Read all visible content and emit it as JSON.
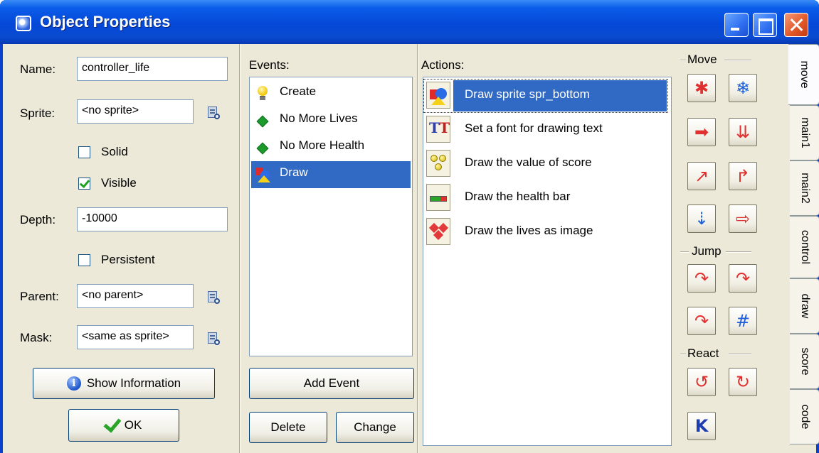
{
  "window": {
    "title": "Object Properties",
    "controls": {
      "minimize": "minimize-icon",
      "maximize": "maximize-icon",
      "close": "close-icon"
    }
  },
  "properties": {
    "name_label": "Name:",
    "name_value": "controller_life",
    "sprite_label": "Sprite:",
    "sprite_value": "<no sprite>",
    "solid_label": "Solid",
    "solid_checked": false,
    "visible_label": "Visible",
    "visible_checked": true,
    "depth_label": "Depth:",
    "depth_value": "-10000",
    "persistent_label": "Persistent",
    "persistent_checked": false,
    "parent_label": "Parent:",
    "parent_value": "<no parent>",
    "mask_label": "Mask:",
    "mask_value": "<same as sprite>",
    "show_info_label": "Show Information",
    "ok_label": "OK"
  },
  "events": {
    "header": "Events:",
    "items": [
      {
        "label": "Create",
        "icon": "lightbulb-icon",
        "selected": false
      },
      {
        "label": "No More Lives",
        "icon": "green-diamond-icon",
        "selected": false
      },
      {
        "label": "No More Health",
        "icon": "green-diamond-icon",
        "selected": false
      },
      {
        "label": "Draw",
        "icon": "draw-shapes-icon",
        "selected": true
      }
    ],
    "add_label": "Add Event",
    "delete_label": "Delete",
    "change_label": "Change"
  },
  "actions": {
    "header": "Actions:",
    "items": [
      {
        "label": "Draw sprite spr_bottom",
        "icon": "draw-sprite-icon",
        "selected": true
      },
      {
        "label": "Set a font for drawing text",
        "icon": "font-icon",
        "selected": false
      },
      {
        "label": "Draw the value of score",
        "icon": "score-icon",
        "selected": false
      },
      {
        "label": "Draw the health bar",
        "icon": "health-bar-icon",
        "selected": false
      },
      {
        "label": "Draw the lives as image",
        "icon": "lives-icon",
        "selected": false
      }
    ]
  },
  "toolbox": {
    "groups": [
      {
        "label": "Move"
      },
      {
        "label": "Jump"
      },
      {
        "label": "React"
      }
    ],
    "tabs": [
      {
        "label": "move",
        "active": true
      },
      {
        "label": "main1",
        "active": false
      },
      {
        "label": "main2",
        "active": false
      },
      {
        "label": "control",
        "active": false
      },
      {
        "label": "draw",
        "active": false
      },
      {
        "label": "score",
        "active": false
      },
      {
        "label": "code",
        "active": false
      }
    ]
  }
}
